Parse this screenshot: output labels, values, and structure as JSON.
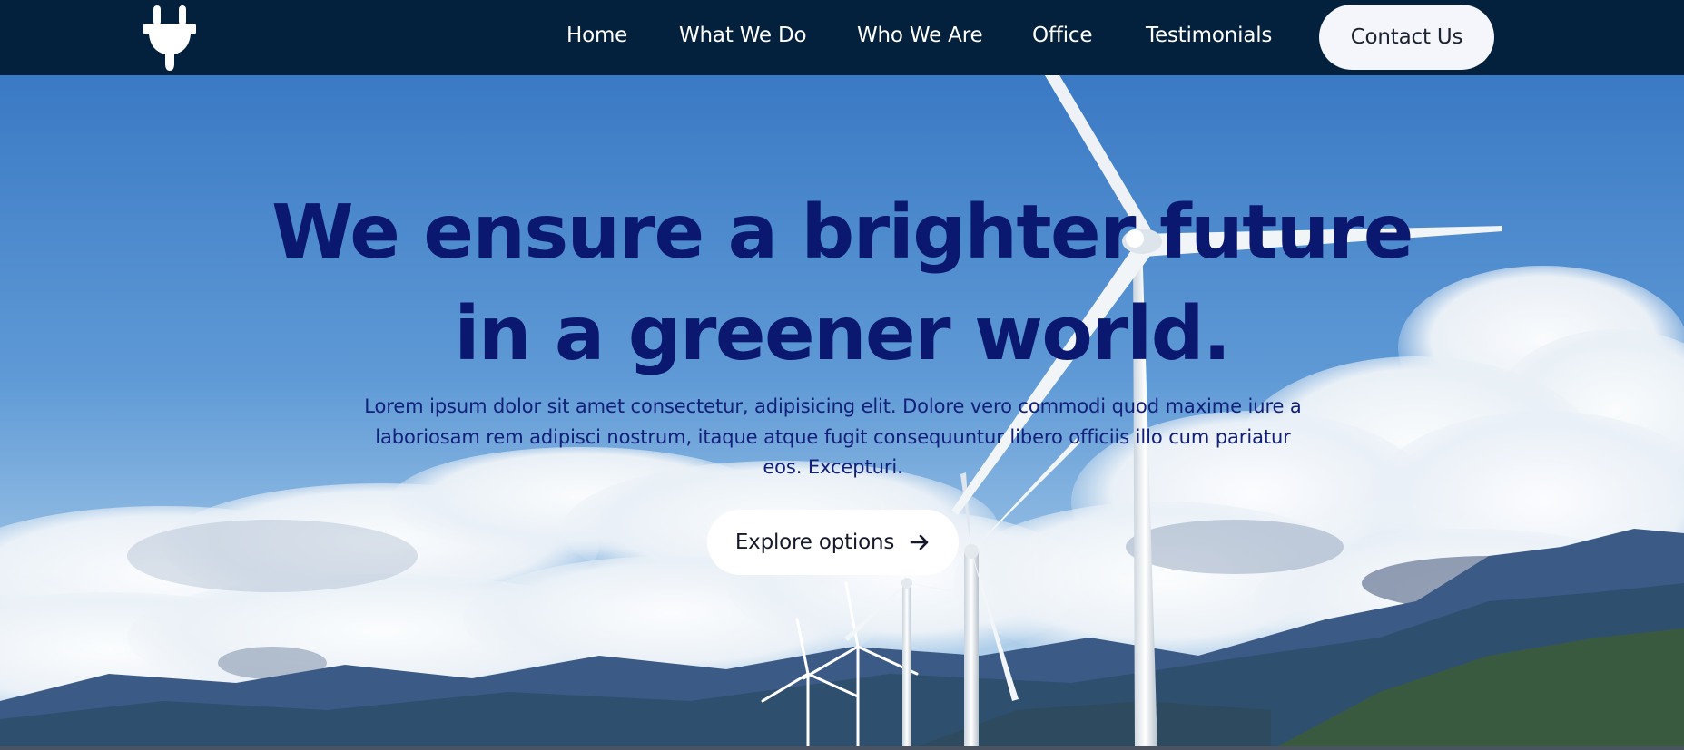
{
  "header": {
    "logo_icon": "plug-icon",
    "nav": [
      {
        "label": "Home"
      },
      {
        "label": "What We Do"
      },
      {
        "label": "Who We Are"
      },
      {
        "label": "Office"
      },
      {
        "label": "Testimonials"
      }
    ],
    "contact_label": "Contact Us"
  },
  "hero": {
    "title_line1": "We ensure a brighter future",
    "title_line2": "in a greener world.",
    "text": "Lorem ipsum dolor sit amet consectetur, adipisicing elit. Dolore vero commodi quod maxime iure a laboriosam rem adipisci nostrum, itaque atque fugit consequuntur libero officiis illo cum pariatur eos. Excepturi.",
    "button_label": "Explore options",
    "button_icon": "arrow-right-icon"
  },
  "colors": {
    "header_bg": "#03203c",
    "title": "#0b1870",
    "sky_top": "#3f7fc9",
    "sky_bottom": "#9ec4e6"
  }
}
